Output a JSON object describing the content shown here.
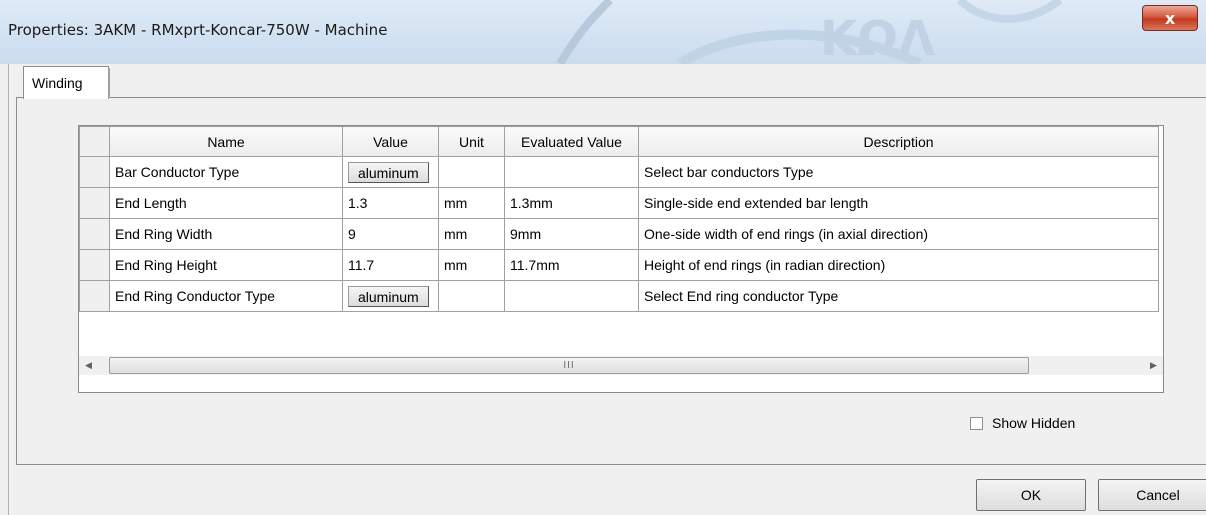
{
  "window": {
    "title": "Properties: 3AKM - RMxprt-Koncar-750W - Machine",
    "close_glyph": "x"
  },
  "tabs": [
    {
      "label": "Winding",
      "active": true
    }
  ],
  "table": {
    "columns": [
      "Name",
      "Value",
      "Unit",
      "Evaluated Value",
      "Description"
    ],
    "rows": [
      {
        "name": "Bar Conductor Type",
        "value": "aluminum",
        "value_is_button": true,
        "unit": "",
        "evaluated": "",
        "description": "Select bar conductors Type"
      },
      {
        "name": "End Length",
        "value": "1.3",
        "value_is_button": false,
        "unit": "mm",
        "evaluated": "1.3mm",
        "description": "Single-side end extended bar length"
      },
      {
        "name": "End Ring Width",
        "value": "9",
        "value_is_button": false,
        "unit": "mm",
        "evaluated": "9mm",
        "description": "One-side width of end rings (in axial direction)"
      },
      {
        "name": "End Ring Height",
        "value": "11.7",
        "value_is_button": false,
        "unit": "mm",
        "evaluated": "11.7mm",
        "description": "Height of  end rings (in radian direction)"
      },
      {
        "name": "End Ring Conductor Type",
        "value": "aluminum",
        "value_is_button": true,
        "unit": "",
        "evaluated": "",
        "description": "Select End ring conductor Type"
      }
    ]
  },
  "scrollbar": {
    "left_icon": "scroll-left-arrow-icon",
    "right_icon": "scroll-right-arrow-icon",
    "grip": "III"
  },
  "show_hidden": {
    "label": "Show Hidden",
    "checked": false
  },
  "buttons": {
    "ok": "OK",
    "cancel": "Cancel"
  },
  "colors": {
    "titlebar": "#d3e2f2",
    "close": "#c23a1f",
    "dialog_bg": "#f0f0f0"
  }
}
